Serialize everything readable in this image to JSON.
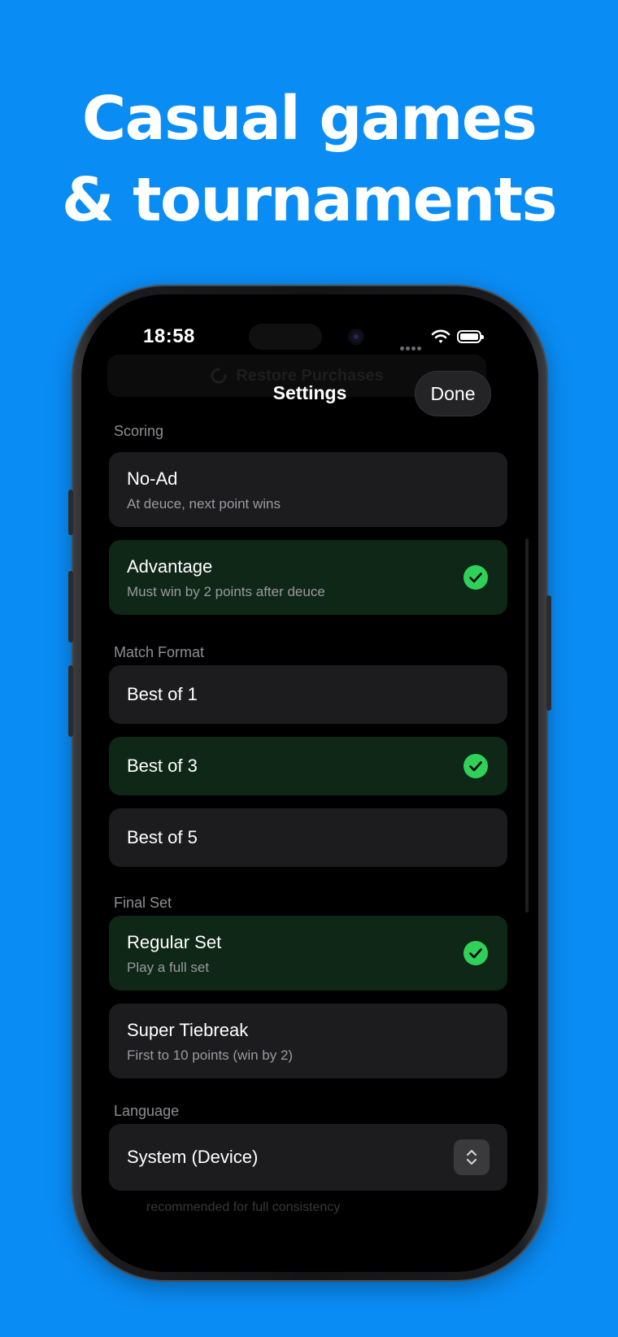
{
  "marketing": {
    "headline_line1": "Casual games",
    "headline_line2": "& tournaments"
  },
  "status_bar": {
    "time": "18:58"
  },
  "sheet": {
    "background_button": "Restore Purchases",
    "title": "Settings",
    "done_label": "Done"
  },
  "sections": {
    "scoring": {
      "header": "Scoring",
      "options": [
        {
          "title": "No-Ad",
          "subtitle": "At deuce, next point wins",
          "selected": false
        },
        {
          "title": "Advantage",
          "subtitle": "Must win by 2 points after deuce",
          "selected": true
        }
      ]
    },
    "match_format": {
      "header": "Match Format",
      "options": [
        {
          "title": "Best of 1",
          "selected": false
        },
        {
          "title": "Best of 3",
          "selected": true
        },
        {
          "title": "Best of 5",
          "selected": false
        }
      ]
    },
    "final_set": {
      "header": "Final Set",
      "options": [
        {
          "title": "Regular Set",
          "subtitle": "Play a full set",
          "selected": true
        },
        {
          "title": "Super Tiebreak",
          "subtitle": "First to 10 points (win by 2)",
          "selected": false
        }
      ]
    },
    "language": {
      "header": "Language",
      "selected_value": "System (Device)",
      "footnote_partial": "recommended for full consistency"
    }
  },
  "colors": {
    "background": "#0a8cf5",
    "card": "#1c1c1e",
    "card_selected": "#0e2717",
    "check": "#30d158"
  }
}
